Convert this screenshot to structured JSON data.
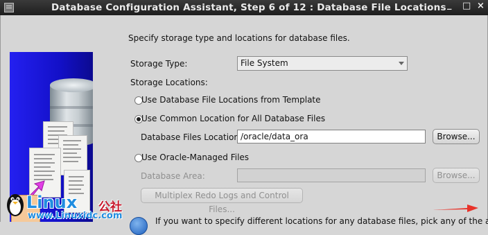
{
  "window": {
    "title": "Database Configuration Assistant, Step 6 of 12 : Database File Locations",
    "minimize_glyph": "_",
    "maximize_glyph": "□",
    "close_glyph": "×"
  },
  "branding": {
    "logo_text": "Linux",
    "logo_cn": "公社",
    "logo_url": "www.Linuxidc.com"
  },
  "main": {
    "intro": "Specify storage type and locations for database files.",
    "storage_type_label": "Storage Type:",
    "storage_type_value": "File System",
    "storage_locations_label": "Storage Locations:",
    "options": {
      "template": {
        "label": "Use Database File Locations from Template",
        "selected": false
      },
      "common": {
        "label": "Use Common Location for All Database Files",
        "selected": true
      },
      "omf": {
        "label": "Use Oracle-Managed Files",
        "selected": false
      }
    },
    "files_location_label": "Database Files Location:",
    "files_location_value": "/oracle/data_ora",
    "browse_label": "Browse...",
    "database_area_label": "Database Area:",
    "database_area_value": "",
    "browse2_label": "Browse...",
    "multiplex_label": "Multiplex Redo Logs and Control Files...",
    "bottom_text": "If you want to specify different locations for any database files, pick any of the above"
  },
  "colors": {
    "accent_blue": "#1b15e0",
    "annotation_red": "#e8332a"
  }
}
